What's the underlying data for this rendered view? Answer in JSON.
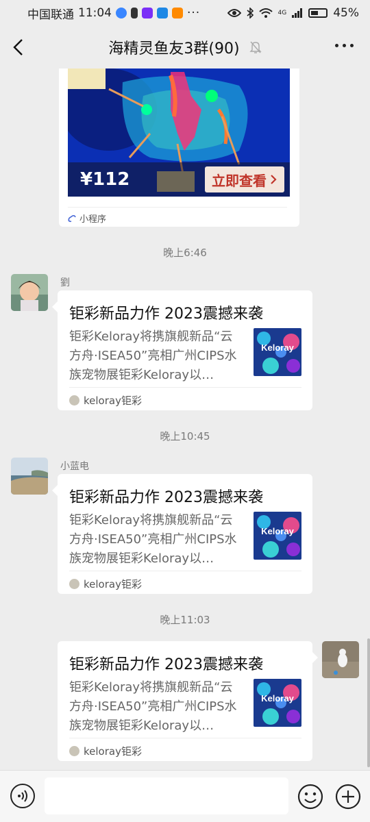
{
  "status_bar": {
    "carrier": "中国联通",
    "time": "11:04",
    "more_indicator": "···",
    "network": "4G",
    "battery": "45%"
  },
  "header": {
    "title": "海精灵鱼友3群(90)",
    "back_icon": "chevron-left-icon",
    "mute_icon": "bell-off-icon",
    "more_icon": "ellipsis-icon"
  },
  "mini_program": {
    "price": "¥112",
    "cta": "立即查看",
    "footer_label": "小程序"
  },
  "messages": [
    {
      "time": "晚上6:46",
      "sender": "劉",
      "article": {
        "title": "钜彩新品力作 2023震撼来袭",
        "description": "钜彩Keloray将携旗舰新品“云方舟·ISEA50”亮相广州CIPS水族宠物展钜彩Keloray以…",
        "thumb_text": "Keloray",
        "source": "keloray钜彩"
      }
    },
    {
      "time": "晚上10:45",
      "sender": "小蓝电",
      "article": {
        "title": "钜彩新品力作 2023震撼来袭",
        "description": "钜彩Keloray将携旗舰新品“云方舟·ISEA50”亮相广州CIPS水族宠物展钜彩Keloray以…",
        "thumb_text": "Keloray",
        "source": "keloray钜彩"
      }
    },
    {
      "time": "晚上11:03",
      "sender": "",
      "article": {
        "title": "钜彩新品力作 2023震撼来袭",
        "description": "钜彩Keloray将携旗舰新品“云方舟·ISEA50”亮相广州CIPS水族宠物展钜彩Keloray以…",
        "thumb_text": "Keloray",
        "source": "keloray钜彩"
      }
    }
  ],
  "input_bar": {
    "voice_icon": "voice-icon",
    "emoji_icon": "emoji-icon",
    "plus_icon": "plus-icon"
  },
  "colors": {
    "background": "#ededed",
    "bubble": "#ffffff",
    "cta_text": "#c0352a"
  }
}
